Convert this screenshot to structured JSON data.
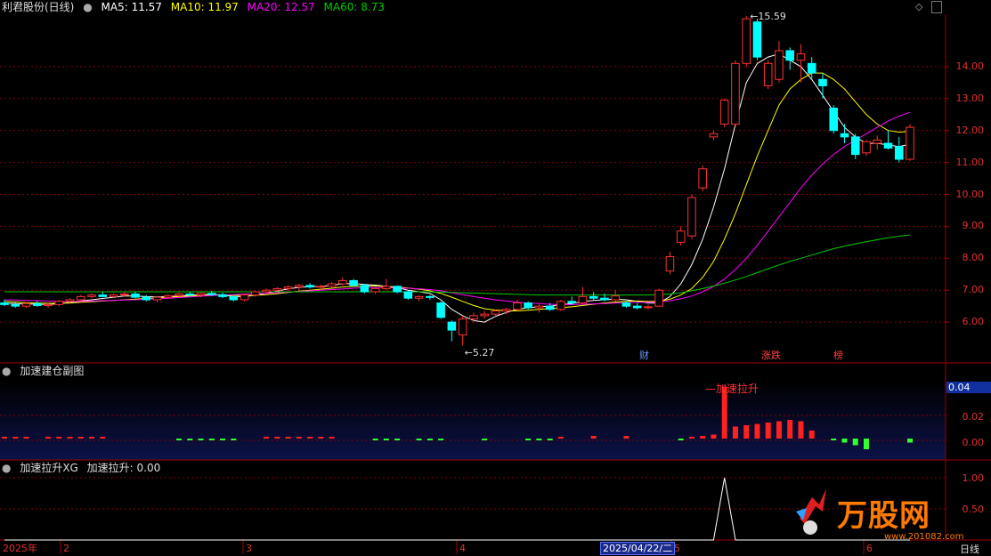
{
  "header": {
    "stock_name": "利君股份(日线)",
    "ma5": "MA5: 11.57",
    "ma10": "MA10: 11.97",
    "ma20": "MA20: 12.57",
    "ma60": "MA60: 8.73"
  },
  "colors": {
    "ma5": "#ffffff",
    "ma10": "#ffff00",
    "ma20": "#ff00ff",
    "ma60": "#00cc00",
    "up": "#ff3030",
    "down": "#00ffff",
    "grid": "#8b0000"
  },
  "main_axis": {
    "labels": [
      "14.00",
      "13.00",
      "12.00",
      "11.00",
      "10.00",
      "9.00",
      "8.00",
      "7.00",
      "6.00"
    ]
  },
  "annotations": {
    "high": "15.59",
    "low": "5.27"
  },
  "badges": {
    "cai": "财",
    "zhangdie": "涨跌",
    "bang": "榜"
  },
  "sub1": {
    "title": "加速建仓副图",
    "label": "加速拉升",
    "axis_value": "0.04",
    "axis_labels": [
      "0.02",
      "0.00"
    ]
  },
  "sub2": {
    "title": "加速拉升XG",
    "value": "加速拉升: 0.00",
    "axis_labels": [
      "1.00",
      "0.50"
    ]
  },
  "date_axis": {
    "labels": [
      "2025年",
      "2",
      "3",
      "4",
      "5",
      "6"
    ],
    "current": "2025/04/22/二",
    "period": "日线"
  },
  "watermark": {
    "brand": "万股网",
    "url": "www.201082.com"
  },
  "icons": {
    "settings": "diamond-icon",
    "scroll": "scroll-icon"
  },
  "chart_data": {
    "type": "candlestick",
    "candles_ohlc": [
      [
        6.6,
        6.7,
        6.5,
        6.55
      ],
      [
        6.55,
        6.65,
        6.45,
        6.5
      ],
      [
        6.5,
        6.62,
        6.45,
        6.58
      ],
      [
        6.58,
        6.66,
        6.48,
        6.52
      ],
      [
        6.52,
        6.6,
        6.45,
        6.55
      ],
      [
        6.55,
        6.7,
        6.5,
        6.65
      ],
      [
        6.65,
        6.75,
        6.6,
        6.7
      ],
      [
        6.7,
        6.85,
        6.65,
        6.8
      ],
      [
        6.8,
        6.9,
        6.75,
        6.85
      ],
      [
        6.85,
        6.95,
        6.78,
        6.8
      ],
      [
        6.8,
        6.9,
        6.75,
        6.85
      ],
      [
        6.85,
        6.95,
        6.8,
        6.88
      ],
      [
        6.88,
        6.95,
        6.75,
        6.78
      ],
      [
        6.78,
        6.85,
        6.65,
        6.7
      ],
      [
        6.7,
        6.82,
        6.62,
        6.78
      ],
      [
        6.78,
        6.88,
        6.72,
        6.83
      ],
      [
        6.83,
        6.92,
        6.78,
        6.88
      ],
      [
        6.88,
        6.95,
        6.8,
        6.85
      ],
      [
        6.85,
        6.92,
        6.78,
        6.9
      ],
      [
        6.9,
        6.98,
        6.82,
        6.86
      ],
      [
        6.86,
        6.92,
        6.75,
        6.8
      ],
      [
        6.8,
        6.85,
        6.65,
        6.7
      ],
      [
        6.7,
        6.88,
        6.65,
        6.85
      ],
      [
        6.85,
        6.98,
        6.8,
        6.95
      ],
      [
        6.95,
        7.05,
        6.88,
        7.0
      ],
      [
        7.0,
        7.1,
        6.92,
        7.05
      ],
      [
        7.05,
        7.15,
        6.98,
        7.1
      ],
      [
        7.1,
        7.2,
        7.0,
        7.15
      ],
      [
        7.15,
        7.22,
        7.05,
        7.1
      ],
      [
        7.1,
        7.18,
        7.02,
        7.12
      ],
      [
        7.12,
        7.25,
        7.08,
        7.2
      ],
      [
        7.2,
        7.4,
        7.15,
        7.3
      ],
      [
        7.3,
        7.35,
        7.1,
        7.15
      ],
      [
        7.15,
        7.2,
        6.9,
        6.95
      ],
      [
        6.95,
        7.1,
        6.88,
        7.05
      ],
      [
        7.05,
        7.35,
        7.0,
        7.12
      ],
      [
        7.12,
        7.15,
        6.9,
        6.95
      ],
      [
        6.95,
        7.0,
        6.7,
        6.75
      ],
      [
        6.75,
        6.85,
        6.65,
        6.8
      ],
      [
        6.8,
        6.85,
        6.7,
        6.78
      ],
      [
        6.6,
        6.65,
        6.1,
        6.15
      ],
      [
        6.0,
        6.05,
        5.4,
        5.75
      ],
      [
        5.6,
        6.2,
        5.27,
        6.1
      ],
      [
        6.1,
        6.3,
        6.0,
        6.2
      ],
      [
        6.2,
        6.35,
        6.1,
        6.25
      ],
      [
        6.25,
        6.4,
        6.15,
        6.35
      ],
      [
        6.35,
        6.45,
        6.25,
        6.4
      ],
      [
        6.4,
        6.7,
        6.35,
        6.6
      ],
      [
        6.6,
        6.65,
        6.4,
        6.45
      ],
      [
        6.45,
        6.55,
        6.3,
        6.5
      ],
      [
        6.5,
        6.6,
        6.35,
        6.4
      ],
      [
        6.4,
        6.7,
        6.35,
        6.65
      ],
      [
        6.65,
        6.8,
        6.55,
        6.6
      ],
      [
        6.6,
        7.1,
        6.55,
        6.8
      ],
      [
        6.8,
        6.95,
        6.7,
        6.75
      ],
      [
        6.75,
        6.9,
        6.65,
        6.7
      ],
      [
        6.7,
        7.0,
        6.65,
        6.82
      ],
      [
        6.6,
        6.65,
        6.45,
        6.5
      ],
      [
        6.5,
        6.6,
        6.4,
        6.45
      ],
      [
        6.45,
        6.55,
        6.4,
        6.48
      ],
      [
        6.5,
        7.05,
        6.48,
        7.0
      ],
      [
        7.6,
        8.2,
        7.5,
        8.05
      ],
      [
        8.5,
        9.0,
        8.4,
        8.85
      ],
      [
        8.7,
        10.0,
        8.6,
        9.9
      ],
      [
        10.2,
        10.9,
        10.1,
        10.8
      ],
      [
        11.8,
        12.0,
        11.7,
        11.9
      ],
      [
        12.2,
        13.0,
        12.1,
        12.95
      ],
      [
        12.2,
        14.2,
        12.1,
        14.1
      ],
      [
        14.1,
        15.59,
        14.0,
        15.5
      ],
      [
        15.4,
        15.5,
        14.2,
        14.3
      ],
      [
        13.4,
        14.2,
        13.3,
        14.1
      ],
      [
        13.6,
        14.8,
        13.5,
        14.5
      ],
      [
        14.5,
        14.6,
        13.9,
        14.2
      ],
      [
        14.2,
        14.7,
        13.5,
        14.4
      ],
      [
        14.1,
        14.3,
        13.6,
        13.8
      ],
      [
        13.6,
        13.8,
        13.0,
        13.4
      ],
      [
        12.7,
        12.8,
        11.9,
        12.0
      ],
      [
        11.9,
        12.2,
        11.6,
        11.8
      ],
      [
        11.8,
        11.9,
        11.1,
        11.25
      ],
      [
        11.3,
        11.7,
        11.2,
        11.65
      ],
      [
        11.6,
        11.85,
        11.4,
        11.7
      ],
      [
        11.6,
        12.0,
        11.4,
        11.45
      ],
      [
        11.5,
        11.8,
        11.0,
        11.1
      ],
      [
        11.1,
        12.2,
        11.05,
        12.1
      ]
    ],
    "ma_series": [
      {
        "name": "MA5",
        "values": [
          6.6,
          6.58,
          6.57,
          6.56,
          6.55,
          6.58,
          6.62,
          6.66,
          6.7,
          6.74,
          6.78,
          6.82,
          6.82,
          6.8,
          6.79,
          6.8,
          6.82,
          6.84,
          6.86,
          6.87,
          6.85,
          6.8,
          6.8,
          6.84,
          6.9,
          6.97,
          7.04,
          7.09,
          7.11,
          7.12,
          7.15,
          7.2,
          7.21,
          7.18,
          7.16,
          7.12,
          7.08,
          7.0,
          6.95,
          6.9,
          6.7,
          6.4,
          6.2,
          6.05,
          6.0,
          6.18,
          6.3,
          6.4,
          6.45,
          6.48,
          6.5,
          6.55,
          6.58,
          6.65,
          6.68,
          6.7,
          6.72,
          6.7,
          6.65,
          6.6,
          6.6,
          6.8,
          7.2,
          7.8,
          8.6,
          9.6,
          10.8,
          12.2,
          13.5,
          14.1,
          14.3,
          14.4,
          14.2,
          14.0,
          13.6,
          13.1,
          12.6,
          12.1,
          11.8,
          11.6,
          11.6,
          11.55,
          11.5,
          11.57
        ]
      },
      {
        "name": "MA10",
        "values": [
          6.65,
          6.63,
          6.61,
          6.6,
          6.59,
          6.59,
          6.6,
          6.62,
          6.64,
          6.66,
          6.68,
          6.7,
          6.72,
          6.74,
          6.76,
          6.78,
          6.8,
          6.82,
          6.84,
          6.85,
          6.85,
          6.84,
          6.83,
          6.84,
          6.86,
          6.89,
          6.93,
          6.97,
          7.0,
          7.03,
          7.06,
          7.1,
          7.12,
          7.13,
          7.13,
          7.12,
          7.1,
          7.07,
          7.03,
          6.98,
          6.9,
          6.78,
          6.65,
          6.52,
          6.42,
          6.38,
          6.35,
          6.35,
          6.37,
          6.4,
          6.42,
          6.45,
          6.48,
          6.52,
          6.56,
          6.6,
          6.63,
          6.65,
          6.66,
          6.65,
          6.65,
          6.72,
          6.85,
          7.05,
          7.4,
          7.9,
          8.6,
          9.4,
          10.3,
          11.2,
          12.0,
          12.8,
          13.3,
          13.6,
          13.8,
          13.8,
          13.6,
          13.3,
          12.9,
          12.5,
          12.2,
          12.0,
          11.95,
          11.97
        ]
      },
      {
        "name": "MA20",
        "values": [
          6.7,
          6.69,
          6.68,
          6.67,
          6.66,
          6.65,
          6.65,
          6.65,
          6.66,
          6.67,
          6.68,
          6.69,
          6.7,
          6.72,
          6.73,
          6.75,
          6.77,
          6.79,
          6.81,
          6.83,
          6.85,
          6.86,
          6.88,
          6.89,
          6.9,
          6.92,
          6.94,
          6.96,
          6.98,
          7.0,
          7.02,
          7.04,
          7.06,
          7.08,
          7.08,
          7.08,
          7.07,
          7.06,
          7.04,
          7.02,
          6.98,
          6.92,
          6.86,
          6.8,
          6.75,
          6.7,
          6.66,
          6.62,
          6.6,
          6.58,
          6.56,
          6.55,
          6.55,
          6.56,
          6.57,
          6.58,
          6.6,
          6.61,
          6.62,
          6.62,
          6.63,
          6.67,
          6.73,
          6.82,
          6.95,
          7.12,
          7.35,
          7.65,
          8.0,
          8.4,
          8.85,
          9.3,
          9.75,
          10.2,
          10.6,
          10.95,
          11.25,
          11.5,
          11.7,
          11.9,
          12.1,
          12.3,
          12.45,
          12.57
        ]
      },
      {
        "name": "MA60",
        "values": [
          6.95,
          6.95,
          6.95,
          6.95,
          6.95,
          6.95,
          6.95,
          6.95,
          6.95,
          6.95,
          6.95,
          6.95,
          6.95,
          6.95,
          6.95,
          6.95,
          6.95,
          6.95,
          6.95,
          6.95,
          6.95,
          6.95,
          6.95,
          6.95,
          6.95,
          6.95,
          6.95,
          6.95,
          6.95,
          6.95,
          6.95,
          6.95,
          6.95,
          6.95,
          6.95,
          6.95,
          6.95,
          6.95,
          6.95,
          6.95,
          6.94,
          6.93,
          6.92,
          6.91,
          6.9,
          6.89,
          6.88,
          6.87,
          6.86,
          6.85,
          6.85,
          6.85,
          6.85,
          6.85,
          6.85,
          6.85,
          6.85,
          6.85,
          6.85,
          6.85,
          6.86,
          6.88,
          6.92,
          6.98,
          7.05,
          7.13,
          7.22,
          7.32,
          7.43,
          7.55,
          7.67,
          7.79,
          7.9,
          8.0,
          8.1,
          8.2,
          8.3,
          8.38,
          8.45,
          8.52,
          8.58,
          8.64,
          8.69,
          8.73
        ]
      }
    ],
    "ylim": [
      5.0,
      16.0
    ],
    "indicator_bars": [
      0.001,
      0.001,
      0.001,
      0,
      0.001,
      0.001,
      0.001,
      0.001,
      0.001,
      0.001,
      0,
      0,
      0,
      0,
      0,
      0,
      -0.001,
      -0.001,
      -0.001,
      -0.001,
      -0.001,
      -0.001,
      0,
      0,
      0.001,
      0.001,
      0.001,
      0.001,
      0.001,
      0.001,
      0.001,
      0,
      0,
      0,
      -0.001,
      -0.001,
      -0.001,
      0,
      -0.001,
      -0.001,
      -0.001,
      0,
      0,
      0,
      -0.001,
      0,
      0,
      0,
      -0.001,
      -0.001,
      -0.001,
      0.001,
      0,
      0,
      0.002,
      0,
      0,
      0.002,
      0,
      0,
      0,
      0,
      -0.001,
      0.001,
      0.002,
      0.003,
      0.039,
      0.009,
      0.01,
      0.011,
      0.012,
      0.013,
      0.014,
      0.013,
      0.006,
      0,
      -0.001,
      -0.003,
      -0.005,
      -0.008,
      0,
      0,
      0,
      -0.003
    ],
    "signal_xg": [
      0,
      0,
      0,
      0,
      0,
      0,
      0,
      0,
      0,
      0,
      0,
      0,
      0,
      0,
      0,
      0,
      0,
      0,
      0,
      0,
      0,
      0,
      0,
      0,
      0,
      0,
      0,
      0,
      0,
      0,
      0,
      0,
      0,
      0,
      0,
      0,
      0,
      0,
      0,
      0,
      0,
      0,
      0,
      0,
      0,
      0,
      0,
      0,
      0,
      0,
      0,
      0,
      0,
      0,
      0,
      0,
      0,
      0,
      0,
      0,
      0,
      0,
      0,
      0,
      0,
      0,
      1,
      0,
      0,
      0,
      0,
      0,
      0,
      0,
      0,
      0,
      0,
      0,
      0,
      0,
      0,
      0,
      0,
      0
    ]
  }
}
